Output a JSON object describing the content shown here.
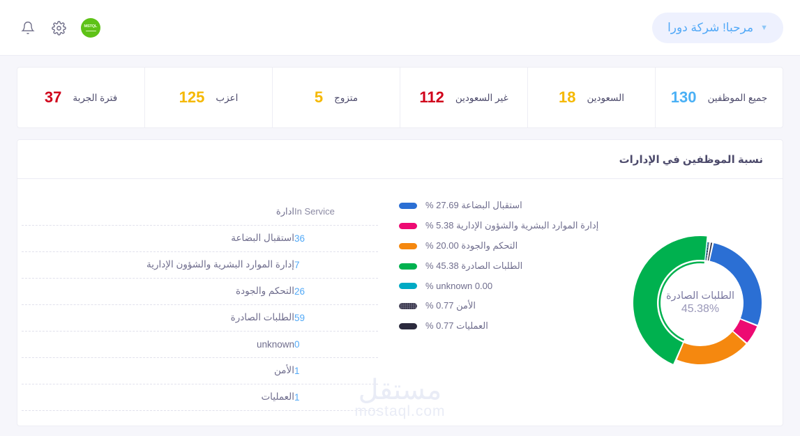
{
  "topbar": {
    "logo_text": "MSTQL",
    "logo_name": "brand-logo",
    "settings_icon": "gear-icon",
    "notifications_icon": "bell-icon",
    "greeting": "مرحبا! شركة دورا",
    "greeting_chevron": "chevron-down-icon"
  },
  "stats": [
    {
      "label": "جميع الموظفين",
      "value": "130",
      "color": "#4ab0f5"
    },
    {
      "label": "السعودين",
      "value": "18",
      "color": "#f5b800"
    },
    {
      "label": "غير السعودين",
      "value": "112",
      "color": "#d0021b"
    },
    {
      "label": "متزوج",
      "value": "5",
      "color": "#f5b800"
    },
    {
      "label": "اعزب",
      "value": "125",
      "color": "#f5b800"
    },
    {
      "label": "فترة الجربة",
      "value": "37",
      "color": "#d0021b"
    }
  ],
  "panel": {
    "title": "نسبة الموظفين في الإدارات",
    "table": {
      "headers": {
        "dept": "ادارة",
        "in_service": "In Service"
      },
      "rows": [
        {
          "dept": "استقبال البضاعة",
          "in_service": "36"
        },
        {
          "dept": "إدارة الموارد البشرية والشؤون الإدارية",
          "in_service": "7"
        },
        {
          "dept": "التحكم والجودة",
          "in_service": "26"
        },
        {
          "dept": "الطلبات الصادرة",
          "in_service": "59"
        },
        {
          "dept": "unknown",
          "in_service": "0"
        },
        {
          "dept": "الأمن",
          "in_service": "1"
        },
        {
          "dept": "العمليات",
          "in_service": "1"
        }
      ]
    },
    "donut_center": {
      "name": "الطلبات الصادرة",
      "percent": "45.38%"
    }
  },
  "chart_data": {
    "type": "pie",
    "title": "نسبة الموظفين في الإدارات",
    "legend_position": "left",
    "unit": "%",
    "center_label": "الطلبات الصادرة",
    "center_value": "45.38%",
    "categories": [
      "استقبال البضاعة",
      "إدارة الموارد البشرية والشؤون الإدارية",
      "التحكم والجودة",
      "الطلبات الصادرة",
      "unknown",
      "الأمن",
      "العمليات"
    ],
    "values": [
      27.69,
      5.38,
      20.0,
      45.38,
      0.0,
      0.77,
      0.77
    ],
    "counts": [
      36,
      7,
      26,
      59,
      0,
      1,
      1
    ],
    "colors": [
      "#2b6fd4",
      "#ed0a72",
      "#f5880f",
      "#00b14f",
      "#00aac4",
      "#6d6b84",
      "#2b2a3d"
    ],
    "legend": [
      {
        "label": "استقبال البضاعة",
        "value": "27.69",
        "text": "استقبال البضاعة 27.69 %",
        "color": "#2b6fd4",
        "pattern": "solid"
      },
      {
        "label": "إدارة الموارد البشرية والشؤون الإدارية",
        "value": "5.38",
        "text": "إدارة الموارد البشرية والشؤون الإدارية 5.38 %",
        "color": "#ed0a72",
        "pattern": "solid"
      },
      {
        "label": "التحكم والجودة",
        "value": "20.00",
        "text": "التحكم والجودة 20.00 %",
        "color": "#f5880f",
        "pattern": "solid"
      },
      {
        "label": "الطلبات الصادرة",
        "value": "45.38",
        "text": "الطلبات الصادرة 45.38 %",
        "color": "#00b14f",
        "pattern": "solid"
      },
      {
        "label": "unknown",
        "value": "0.00",
        "text": "unknown 0.00 %",
        "color": "#00aac4",
        "pattern": "solid"
      },
      {
        "label": "الأمن",
        "value": "0.77",
        "text": "الأمن 0.77 %",
        "color": "#6d6b84",
        "pattern": "dotted"
      },
      {
        "label": "العمليات",
        "value": "0.77",
        "text": "العمليات 0.77 %",
        "color": "#2b2a3d",
        "pattern": "solid"
      }
    ]
  },
  "watermark": {
    "arabic": "مستقل",
    "latin": "mostaql.com"
  }
}
